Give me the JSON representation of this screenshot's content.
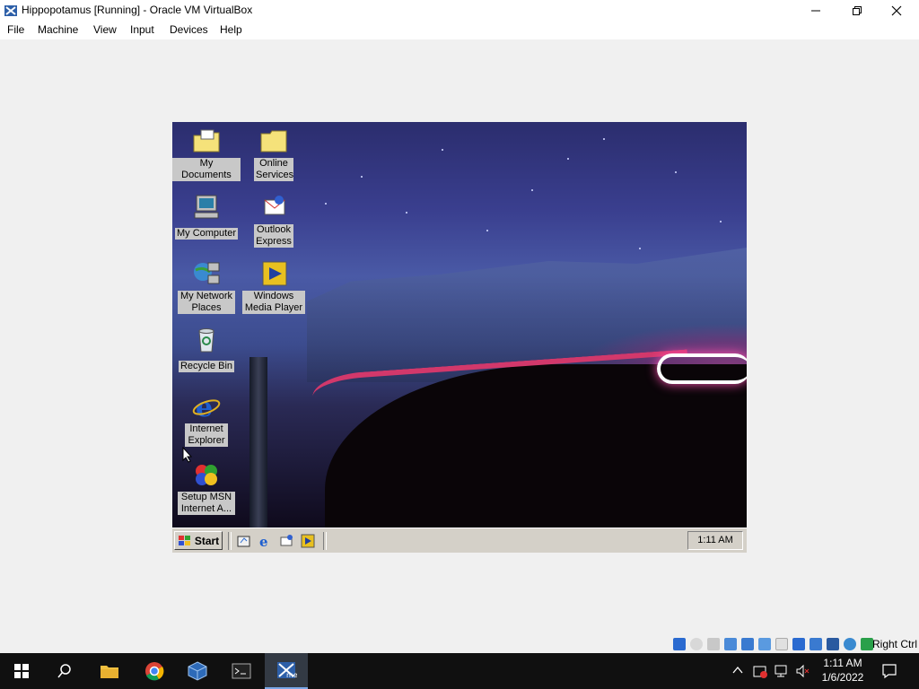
{
  "window": {
    "title": "Hippopotamus [Running] - Oracle VM VirtualBox"
  },
  "menu": {
    "items": [
      "File",
      "Machine",
      "View",
      "Input",
      "Devices",
      "Help"
    ]
  },
  "guest": {
    "desktop_icons": [
      {
        "label": "My Documents",
        "icon": "my-documents-icon"
      },
      {
        "label": "Online Services",
        "icon": "folder-icon"
      },
      {
        "label": "My Computer",
        "icon": "computer-icon"
      },
      {
        "label": "Outlook Express",
        "icon": "outlook-express-icon"
      },
      {
        "label": "My Network Places",
        "icon": "network-places-icon"
      },
      {
        "label": "Windows Media Player",
        "icon": "media-player-icon"
      },
      {
        "label": "Recycle Bin",
        "icon": "recycle-bin-icon"
      },
      {
        "label": "Internet Explorer",
        "icon": "internet-explorer-icon"
      },
      {
        "label": "Setup MSN Internet A...",
        "icon": "msn-icon"
      }
    ],
    "taskbar": {
      "start_label": "Start",
      "clock": "1:11 AM"
    }
  },
  "vbox_status": {
    "host_key": "Right Ctrl"
  },
  "host_taskbar": {
    "time": "1:11 AM",
    "date": "1/6/2022"
  },
  "colors": {
    "host_bg": "#f0f0f0",
    "win98_gray": "#d4d0c8",
    "w10_taskbar": "#101010"
  }
}
